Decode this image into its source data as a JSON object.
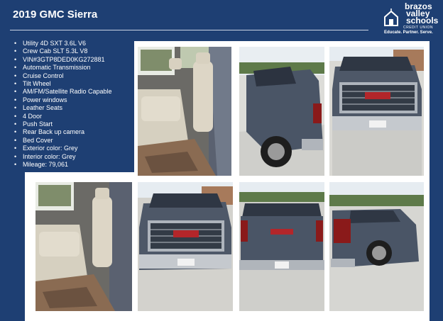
{
  "page_title": "2019 GMC Sierra",
  "logo": {
    "line1": "brazos",
    "line2": "valley",
    "line3": "schools",
    "line4": "CREDIT UNION",
    "tagline": "Educate. Partner. Serve."
  },
  "specs": [
    "Utility 4D SXT 3.6L V6",
    "Crew Cab SLT 5.3L V8",
    "VIN#3GTP8DED0KG272881",
    "Automatic Transmission",
    "Cruise Control",
    "Tilt Wheel",
    "AM/FM/Satellite Radio Capable",
    "Power windows",
    "Leather Seats",
    "4 Door",
    "Push Start",
    "Rear Back up camera",
    "Bed Cover",
    "Exterior color:  Grey",
    "Interior color: Grey",
    "Mileage: 79,061"
  ],
  "photos": [
    "rear-seat-interior",
    "side-rear-view",
    "front-grille-view",
    "rear-seat-interior-2",
    "front-view",
    "rear-tailgate-view",
    "rear-quarter-view"
  ]
}
